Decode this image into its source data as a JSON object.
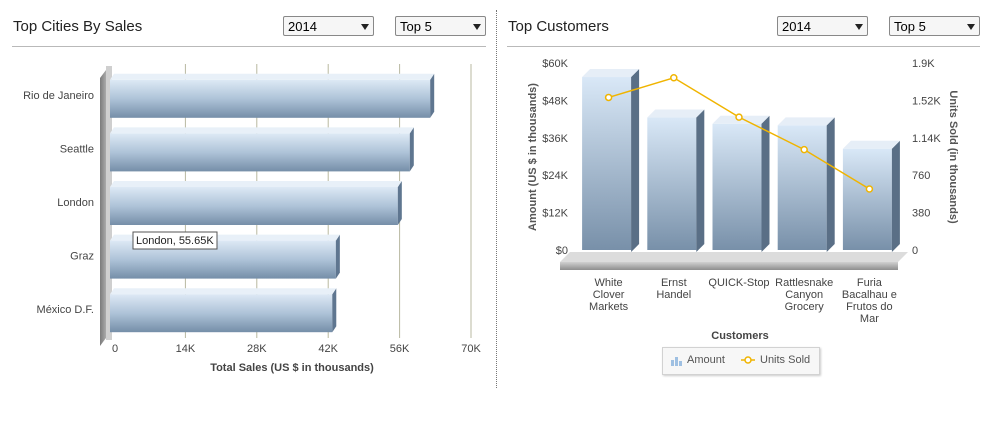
{
  "left": {
    "title": "Top Cities By Sales",
    "year_select": "2014",
    "top_select": "Top 5",
    "tooltip": "London, 55.65K"
  },
  "right": {
    "title": "Top Customers",
    "year_select": "2014",
    "top_select": "Top 5",
    "legend": {
      "amount": "Amount",
      "units": "Units Sold"
    }
  },
  "colors": {
    "bar_light": "#d8e6f3",
    "bar_dark": "#7f97b0",
    "line": "#f0b400",
    "wall": "#9a9a9a"
  },
  "chart_data": [
    {
      "type": "bar",
      "orientation": "horizontal",
      "categories": [
        "Rio de Janeiro",
        "Seattle",
        "London",
        "Graz",
        "México D.F."
      ],
      "values": [
        62.0,
        58.0,
        55.65,
        43.5,
        42.8
      ],
      "xlabel": "Total Sales (US $ in thousands)",
      "xticks": [
        "0",
        "14K",
        "28K",
        "42K",
        "56K",
        "70K"
      ],
      "xlim": [
        0,
        70
      ],
      "grid": true
    },
    {
      "type": "bar",
      "categories": [
        [
          "White",
          "Clover",
          "Markets"
        ],
        [
          "Ernst",
          "Handel"
        ],
        [
          "QUICK-Stop"
        ],
        [
          "Rattlesnake",
          "Canyon",
          "Grocery"
        ],
        [
          "Furia",
          "Bacalhau e",
          "Frutos do",
          "Mar"
        ]
      ],
      "xlabel": "Customers",
      "series": [
        {
          "name": "Amount",
          "axis": "left",
          "type": "bar",
          "values": [
            55.5,
            42.5,
            40.5,
            40.0,
            32.5
          ]
        },
        {
          "name": "Units Sold",
          "axis": "right",
          "type": "line",
          "values": [
            1550,
            1750,
            1350,
            1020,
            620
          ]
        }
      ],
      "ylabel": "Amount (US $ in thousands)",
      "ylabel_right": "Units Sold (in thousands)",
      "yticks": [
        "$0",
        "$12K",
        "$24K",
        "$36K",
        "$48K",
        "$60K"
      ],
      "yticks_right": [
        "0",
        "380",
        "760",
        "1.14K",
        "1.52K",
        "1.9K"
      ],
      "ylim": [
        0,
        60
      ],
      "ylim_right": [
        0,
        1900
      ]
    }
  ]
}
